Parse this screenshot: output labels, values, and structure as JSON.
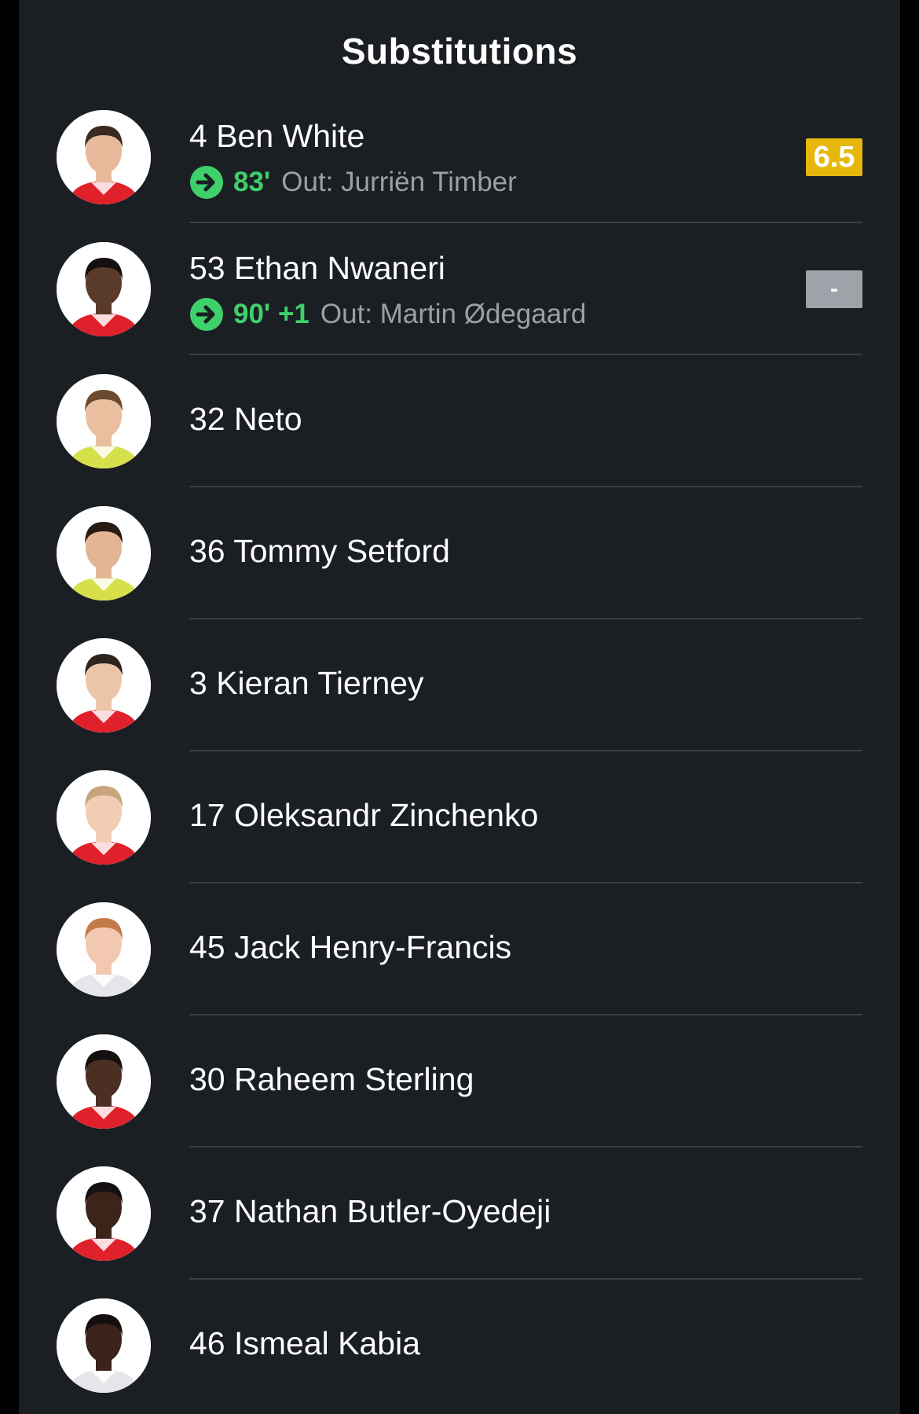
{
  "section_title": "Substitutions",
  "colors": {
    "background": "#1b1f23",
    "divider": "#3a3f45",
    "sub_green": "#3ed16b",
    "rating_gold": "#e5b80b",
    "rating_grey": "#9ea3aa"
  },
  "players": [
    {
      "label": "4 Ben White",
      "substituted_in": true,
      "sub_icon": "arrow-right-circle-icon",
      "minute": "83'",
      "out_text": "Out: Jurriën Timber",
      "rating": "6.5",
      "rating_style": "good",
      "kit": "red"
    },
    {
      "label": "53 Ethan Nwaneri",
      "substituted_in": true,
      "sub_icon": "arrow-right-circle-icon",
      "minute": "90' +1",
      "out_text": "Out: Martin Ødegaard",
      "rating": "-",
      "rating_style": "none",
      "kit": "red"
    },
    {
      "label": "32 Neto",
      "kit": "yellow"
    },
    {
      "label": "36 Tommy Setford",
      "kit": "yellow"
    },
    {
      "label": "3 Kieran Tierney",
      "kit": "red"
    },
    {
      "label": "17 Oleksandr Zinchenko",
      "kit": "red"
    },
    {
      "label": "45 Jack Henry-Francis",
      "kit": "white"
    },
    {
      "label": "30 Raheem Sterling",
      "kit": "red"
    },
    {
      "label": "37 Nathan Butler-Oyedeji",
      "kit": "red"
    },
    {
      "label": "46 Ismeal Kabia",
      "kit": "white"
    }
  ]
}
